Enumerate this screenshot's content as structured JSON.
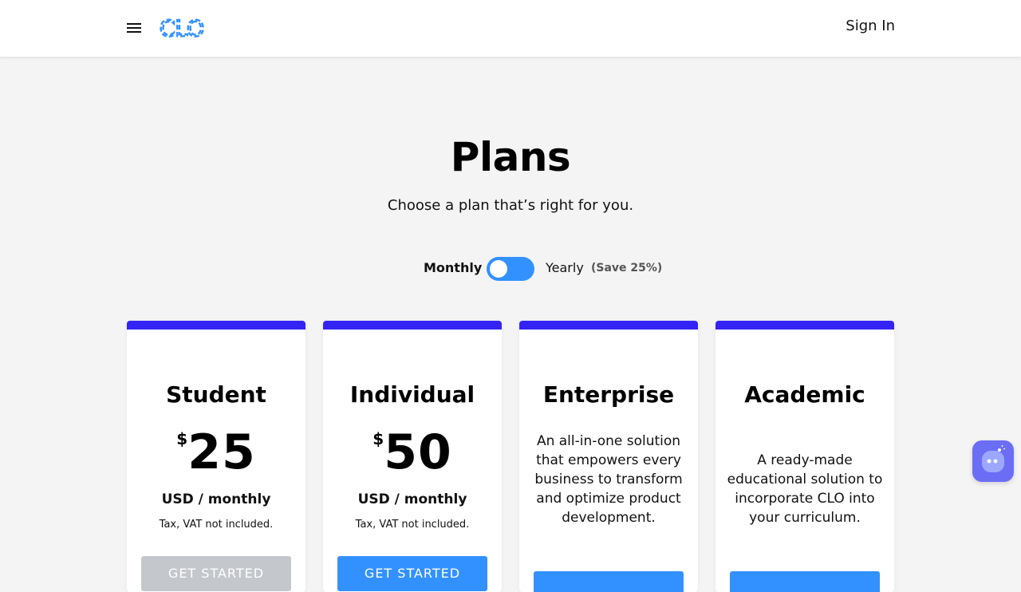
{
  "header": {
    "sign_in": "Sign In",
    "logo_text": "CLO"
  },
  "hero": {
    "title": "Plans",
    "subtitle": "Choose a plan that’s right for you."
  },
  "billing_toggle": {
    "monthly_label": "Monthly",
    "yearly_label": "Yearly",
    "save_label": "(Save 25%)"
  },
  "plans": [
    {
      "name": "Student",
      "currency": "$",
      "price": "25",
      "unit": "USD / monthly",
      "tax": "Tax, VAT not included.",
      "button": "GET STARTED"
    },
    {
      "name": "Individual",
      "currency": "$",
      "price": "50",
      "unit": "USD / monthly",
      "tax": "Tax, VAT not included.",
      "button": "GET STARTED"
    },
    {
      "name": "Enterprise",
      "description": "An all-in-one solution that empowers every business to transform and optimize product development."
    },
    {
      "name": "Academic",
      "description": "A ready-made educational solution to incorporate CLO into your curriculum."
    }
  ],
  "colors": {
    "accent": "#3291ff",
    "card_bar": "#3324f5",
    "disabled_button": "#c4c7cc",
    "chat_button": "#6b6ef5"
  },
  "icons": {
    "menu": "menu-icon",
    "chat": "chatbot-icon"
  }
}
